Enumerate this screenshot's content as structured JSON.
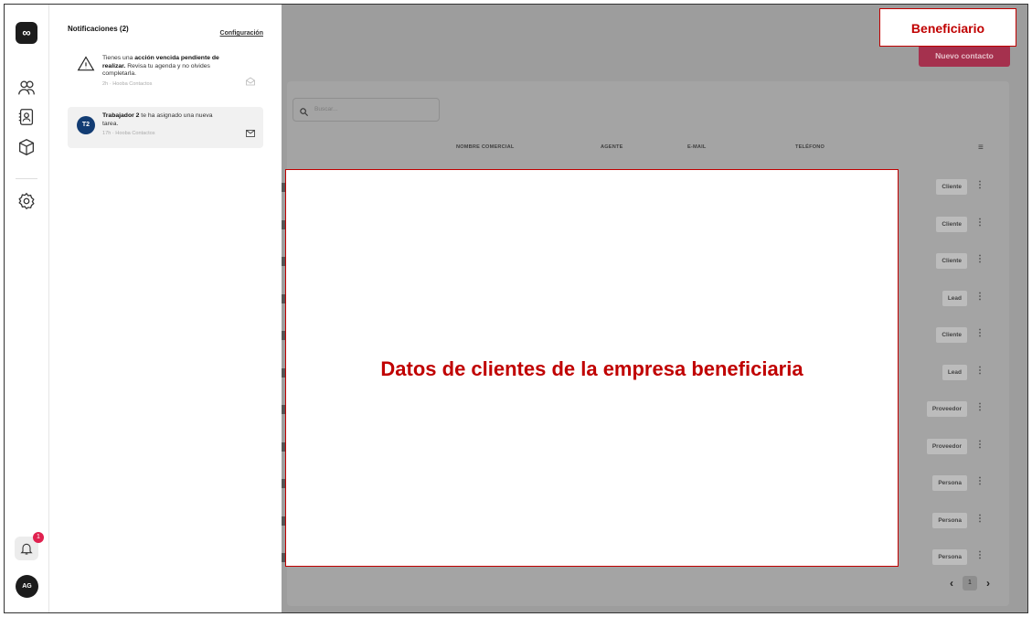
{
  "rail": {
    "logo": "∞",
    "icons": [
      "users-icon",
      "contact-card-icon",
      "box-icon",
      "settings-icon"
    ],
    "bell_badge": "1",
    "avatar": "AG"
  },
  "notifications": {
    "title": "Notificaciones (2)",
    "config_label": "Configuración",
    "item1": {
      "text_pre": "Tienes una ",
      "text_bold": "acción vencida pendiente de realizar.",
      "text_post": " Revisa tu agenda y no olvides completarla.",
      "time": "2h · Hooba Contactos"
    },
    "item2": {
      "avatar": "T2",
      "text_bold": "Trabajador 2",
      "text_post": " te ha asignado una nueva tarea.",
      "time": "17h · Hooba Contactos"
    }
  },
  "content": {
    "new_contact_label": "Nuevo contacto",
    "search_placeholder": "Buscar...",
    "columns": {
      "nombre_comercial": "NOMBRE COMERCIAL",
      "agente": "AGENTE",
      "email": "E-MAIL",
      "telefono": "TELÉFONO"
    },
    "rows": [
      {
        "tag": "Cliente"
      },
      {
        "tag": "Cliente"
      },
      {
        "tag": "Cliente"
      },
      {
        "tag": "Lead"
      },
      {
        "tag": "Cliente"
      },
      {
        "tag": "Lead"
      },
      {
        "tag": "Proveedor"
      },
      {
        "tag": "Proveedor"
      },
      {
        "tag": "Persona"
      },
      {
        "tag": "Persona"
      },
      {
        "tag": "Persona"
      }
    ],
    "pager": {
      "prev": "‹",
      "page": "1",
      "next": "›"
    }
  },
  "overlay": {
    "main_text": "Datos de clientes de la empresa beneficiaria",
    "corner_label": "Beneficiario"
  },
  "colors": {
    "accent": "#c00000",
    "primary_button": "#e0214f",
    "avatar_t2": "#123c73"
  }
}
